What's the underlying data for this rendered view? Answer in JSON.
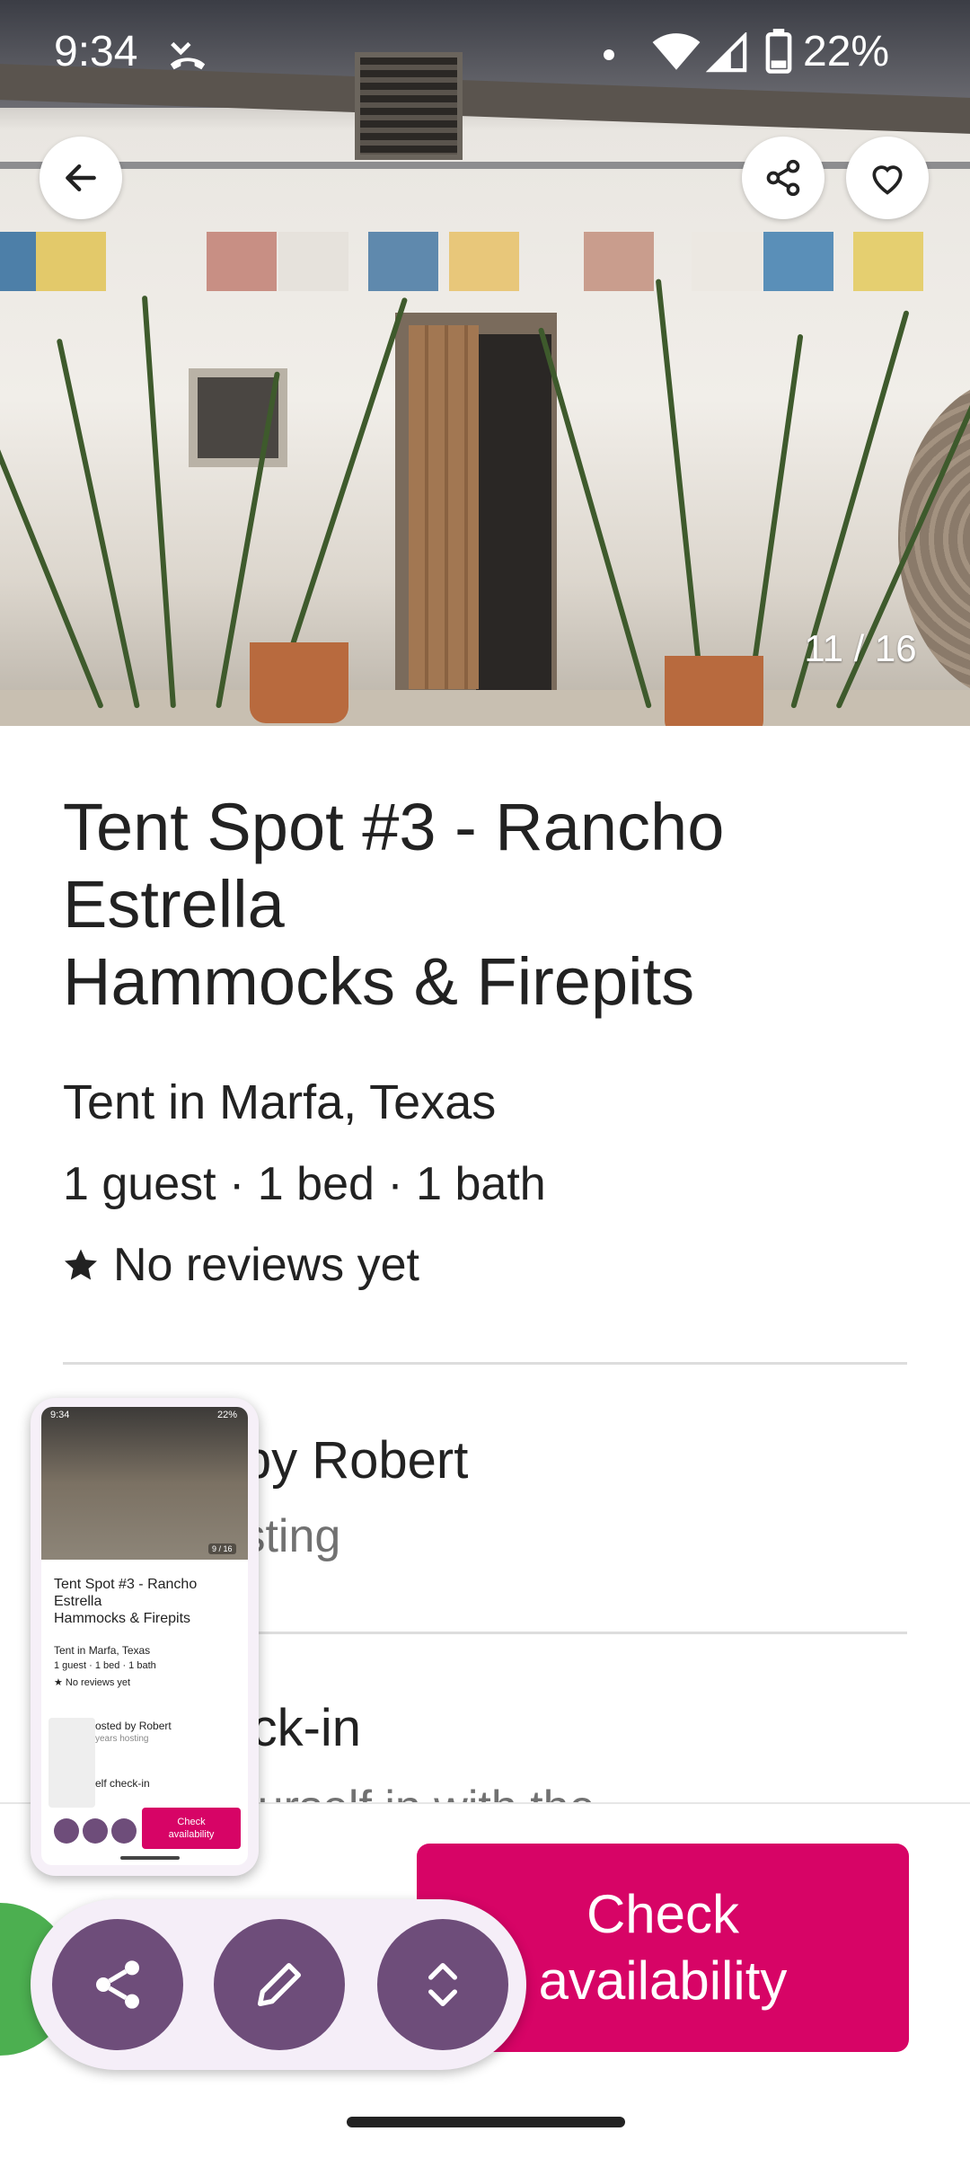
{
  "status_bar": {
    "time": "9:34",
    "battery": "22%"
  },
  "gallery": {
    "counter": "11 / 16"
  },
  "listing": {
    "title_lines": [
      "Tent Spot #3 - Rancho",
      "Estrella",
      "Hammocks & Firepits"
    ],
    "subtitle": "Tent in Marfa, Texas",
    "details": "1 guest · 1 bed · 1 bath",
    "reviews": "No reviews yet"
  },
  "host": {
    "title": "Hosted by Robert",
    "subtitle": "years hosting"
  },
  "checkin": {
    "title": "Self check-in",
    "subtitle": "Check yourself in with the"
  },
  "cta": {
    "line1": "Check",
    "line2": "availability"
  },
  "thumbnail": {
    "time": "9:34",
    "battery": "22%",
    "counter": "9 / 16",
    "title_lines": [
      "Tent Spot #3 - Rancho",
      "Estrella",
      "Hammocks & Firepits"
    ],
    "subtitle": "Tent in Marfa, Texas",
    "details": "1 guest · 1 bed · 1 bath",
    "reviews": "★ No reviews yet",
    "host": "osted by Robert",
    "host_sub": "years hosting",
    "checkin": "elf check-in",
    "cta": [
      "Check",
      "availability"
    ]
  },
  "colors": {
    "accent": "#D70466",
    "overlay_button": "#6E4D7A",
    "overlay_bg": "#F5EEF8"
  }
}
